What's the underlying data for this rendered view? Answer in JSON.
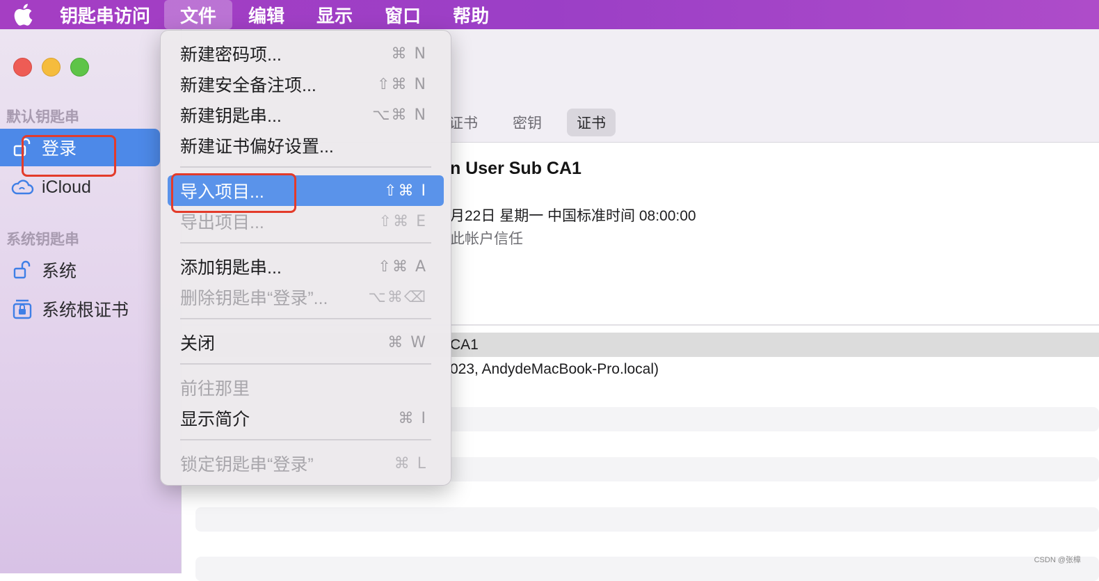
{
  "menubar": {
    "app_name": "钥匙串访问",
    "items": [
      "文件",
      "编辑",
      "显示",
      "窗口",
      "帮助"
    ],
    "active_index": 0
  },
  "sidebar": {
    "section_default": "默认钥匙串",
    "section_system": "系统钥匙串",
    "items": [
      {
        "label": "登录",
        "icon": "lock-open-icon",
        "selected": true
      },
      {
        "label": "iCloud",
        "icon": "cloud-icon"
      },
      {
        "label": "系统",
        "icon": "lock-open-icon"
      },
      {
        "label": "系统根证书",
        "icon": "cabinet-lock-icon"
      }
    ]
  },
  "toolbar": {
    "tabs": [
      "证书",
      "密钥",
      "证书"
    ],
    "selected_tab": 2
  },
  "detail": {
    "title_fragment": "n User Sub CA1",
    "expiry_fragment": "月22日 星期一 中国标准时间 08:00:00",
    "trust_fragment": "此帐户信任"
  },
  "list": {
    "rows": [
      "CA1",
      "023, AndydeMacBook-Pro.local)"
    ]
  },
  "file_menu": {
    "items": [
      {
        "label": "新建密码项...",
        "shortcut": "⌘ N"
      },
      {
        "label": "新建安全备注项...",
        "shortcut": "⇧⌘ N"
      },
      {
        "label": "新建钥匙串...",
        "shortcut": "⌥⌘ N"
      },
      {
        "label": "新建证书偏好设置...",
        "shortcut": ""
      },
      {
        "label": "导入项目...",
        "shortcut": "⇧⌘ I",
        "highlighted": true
      },
      {
        "label": "导出项目...",
        "shortcut": "⇧⌘ E",
        "disabled": true
      },
      {
        "label": "添加钥匙串...",
        "shortcut": "⇧⌘ A"
      },
      {
        "label": "删除钥匙串“登录”...",
        "shortcut": "⌥⌘⌫",
        "disabled": true
      },
      {
        "label": "关闭",
        "shortcut": "⌘ W"
      },
      {
        "label": "前往那里",
        "shortcut": "",
        "disabled": true
      },
      {
        "label": "显示简介",
        "shortcut": "⌘ I"
      },
      {
        "label": "锁定钥匙串“登录”",
        "shortcut": "⌘ L",
        "disabled": true
      }
    ]
  },
  "colors": {
    "menubar": "#9b3fc6",
    "selection": "#4d89e8",
    "annotation": "#e33b2a"
  },
  "watermark": "CSDN @张樟"
}
